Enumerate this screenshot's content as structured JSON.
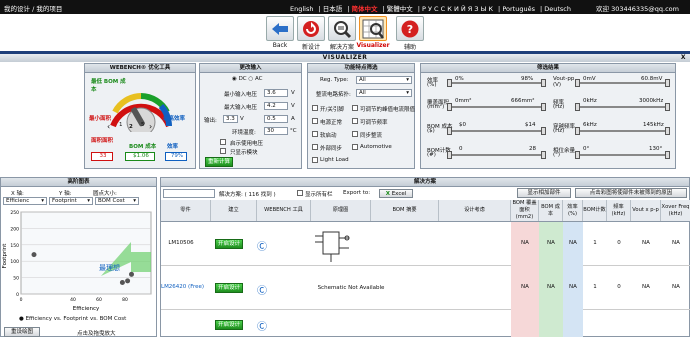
{
  "topbar": {
    "breadcrumb": "我的设计 / 我的项目",
    "languages": [
      "English",
      "日本語",
      "简体中文",
      "繁體中文",
      "Р У С С К И Й  Я З Ы К",
      "Português",
      "Deutsch"
    ],
    "active_language": "简体中文",
    "user": "欢迎 303446335@qq.com"
  },
  "toolbar": {
    "buttons": [
      {
        "label": "Back",
        "icon": "back-arrow-icon"
      },
      {
        "label": "新设计",
        "icon": "refresh-icon"
      },
      {
        "label": "解决方案",
        "icon": "magnifier-icon"
      },
      {
        "label": "Visualizer",
        "icon": "visualizer-icon",
        "selected": true
      },
      {
        "label": "辅助",
        "icon": "help-icon"
      }
    ]
  },
  "visualizer_bar": {
    "title": "VISUALIZER",
    "close": "X"
  },
  "optimizer": {
    "title": "WEBENCH® 优化工具",
    "top_left_label": "最低 BOM 成本",
    "left_label": "最小面积",
    "right_label": "最高效率",
    "dial_min": "1",
    "dial_max": "5",
    "dial_value": "2",
    "stat_labels": [
      "面积面积",
      "BOM 成本",
      "效率"
    ],
    "stat_values": [
      "33",
      "$1.06",
      "79%"
    ],
    "colors": {
      "area": "#d01010",
      "bom": "#1a8a1a",
      "eff": "#1060c0"
    }
  },
  "inputs": {
    "title": "更改输入",
    "mode_dc": "DC",
    "mode_ac": "AC",
    "fields": [
      {
        "label": "最小输入电压",
        "value": "3.6",
        "unit": "V"
      },
      {
        "label": "最大输入电压",
        "value": "4.2",
        "unit": "V"
      },
      {
        "label": "输出:",
        "value": "3.3",
        "unit": "V"
      },
      {
        "label": "环境温度:",
        "value": "30",
        "unit": "°C"
      }
    ],
    "out_current": "0.5",
    "out_current_unit": "A",
    "opt1": "启示使用电压",
    "opt2": "只显示模块",
    "recalc": "重新计算"
  },
  "features": {
    "title": "功能特点筛选",
    "reg_type_label": "Reg. Type:",
    "reg_type_value": "All",
    "topology_label": "整流电路拓扑:",
    "topology_value": "All",
    "checks_left": [
      "开/关引脚",
      "电源正常",
      "软启动",
      "外部同步",
      "Light Load"
    ],
    "checks_right": [
      "可调节的峰值电流限值",
      "可调节频率",
      "同步整流",
      "Automotive"
    ]
  },
  "filters": {
    "title": "筛选结果",
    "rows": [
      {
        "label": "效率",
        "unit": "(%)",
        "min": "0%",
        "max": "98%"
      },
      {
        "label": "覆盖面积",
        "unit": "(mm²)",
        "min": "0mm²",
        "max": "666mm²"
      },
      {
        "label": "BOM 成本",
        "unit": "($)",
        "min": "$0",
        "max": "$14"
      },
      {
        "label": "BOM计数",
        "unit": "(#)",
        "min": "0",
        "max": "28"
      }
    ],
    "rows_right": [
      {
        "label": "Vout-pp",
        "unit": "(V)",
        "min": "0mV",
        "max": "60.8mV"
      },
      {
        "label": "频率",
        "unit": "(Hz)",
        "min": "0kHz",
        "max": "3000kHz"
      },
      {
        "label": "穿越频率",
        "unit": "(Hz)",
        "min": "6kHz",
        "max": "145kHz"
      },
      {
        "label": "相位余量",
        "unit": "(°)",
        "min": "0°",
        "max": "130°"
      }
    ]
  },
  "chart_panel": {
    "title": "高阶图表",
    "x_axis_label": "X 轴:",
    "y_axis_label": "Y 轴:",
    "bubble_label": "圆点大小:",
    "x_select": "Efficienc",
    "y_select": "Footprint",
    "size_select": "BOM Cost",
    "hint": "最理想",
    "xlabel": "Efficiency",
    "ylabel": "Footprint",
    "caption": "Efficiency vs. Footprint vs. BOM Cost",
    "reset_button": "重设绘图",
    "zoom_hint": "点击及拖曳放大"
  },
  "chart_data": {
    "type": "scatter",
    "x_ticks": [
      "0",
      "40",
      "60",
      "80"
    ],
    "y_ticks": [
      "0",
      "50",
      "100",
      "150",
      "200",
      "250"
    ],
    "xlabel": "Efficiency",
    "ylabel": "Footprint",
    "points": [
      {
        "x": 10,
        "y": 120
      },
      {
        "x": 78,
        "y": 35
      },
      {
        "x": 82,
        "y": 40
      },
      {
        "x": 85,
        "y": 60
      }
    ]
  },
  "solutions": {
    "title": "解决方案",
    "count_label": "解决方案: ( 116 找到 )",
    "show_all": "显示所有栏",
    "export_label": "Export to:",
    "excel": "Excel",
    "btn_show_parts": "显示相加部件",
    "btn_click": "点击彩图将使部件未被筛到的原因",
    "columns": [
      "零件",
      "建立",
      "WEBENCH 工具",
      "原理图",
      "BOM 摘要",
      "设计考虑",
      "BOM 覆盖面积 (mm2)",
      "BOM 成本",
      "效率 (%)",
      "BOM计数",
      "频率 (kHz)",
      "Vout x p-p",
      "Xover Freq (kHz)"
    ],
    "rows": [
      {
        "part": "LM10506",
        "build": "开启设计",
        "schematic": "",
        "values": [
          "NA",
          "NA",
          "NA",
          "1",
          "0",
          "NA",
          "NA"
        ]
      },
      {
        "part": "LM26420 (Free)",
        "build": "开启设计",
        "schematic": "Schematic Not Available",
        "values": [
          "NA",
          "NA",
          "NA",
          "1",
          "0",
          "NA",
          "NA"
        ]
      },
      {
        "part": "",
        "build": "开启设计",
        "schematic": "",
        "values": [
          "",
          "",
          "",
          "",
          "",
          "",
          ""
        ]
      }
    ]
  }
}
